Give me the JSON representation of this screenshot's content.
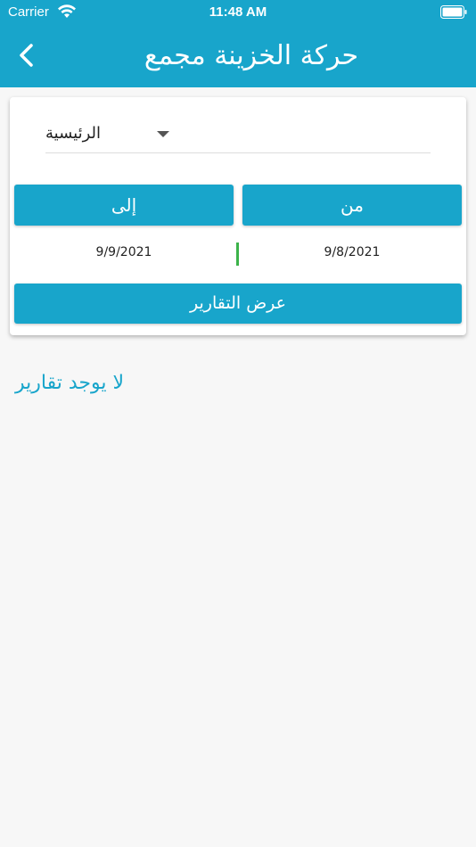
{
  "status_bar": {
    "carrier": "Carrier",
    "time": "11:48 AM"
  },
  "header": {
    "title": "حركة الخزينة مجمع",
    "background": "#18a5cb"
  },
  "filter": {
    "selected_treasury": "الرئيسية",
    "from_label": "من",
    "to_label": "إلى",
    "from_date": "9/8/2021",
    "to_date": "9/9/2021",
    "show_reports_label": "عرض التقارير"
  },
  "results": {
    "empty_message": "لا يوجد تقارير"
  },
  "colors": {
    "accent": "#18a5cb",
    "divider": "#3cb34a",
    "background": "#f7f7f7"
  }
}
